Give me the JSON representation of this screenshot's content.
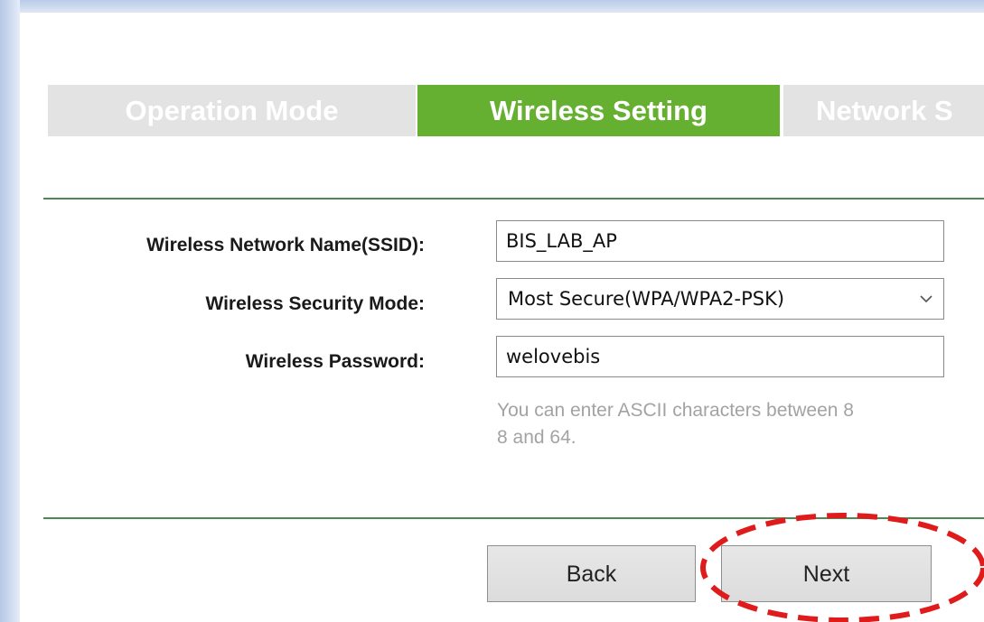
{
  "tabs": [
    {
      "label": "Operation Mode",
      "active": false
    },
    {
      "label": "Wireless Setting",
      "active": true
    },
    {
      "label": "Network S",
      "active": false
    }
  ],
  "form": {
    "ssid_label": "Wireless Network Name(SSID):",
    "ssid_value": "BIS_LAB_AP",
    "security_label": "Wireless Security Mode:",
    "security_value": "Most Secure(WPA/WPA2-PSK)",
    "password_label": "Wireless Password:",
    "password_value": "welovebis",
    "hint_line1": "You can enter ASCII characters between 8",
    "hint_line2": "8 and 64."
  },
  "buttons": {
    "back_label": "Back",
    "next_label": "Next"
  },
  "colors": {
    "active_tab": "#66b031",
    "inactive_tab": "#e3e3e3",
    "divider": "#4b8a53",
    "highlight": "#e01b1b"
  },
  "icons": {
    "select_arrow": "chevron-down-icon"
  }
}
